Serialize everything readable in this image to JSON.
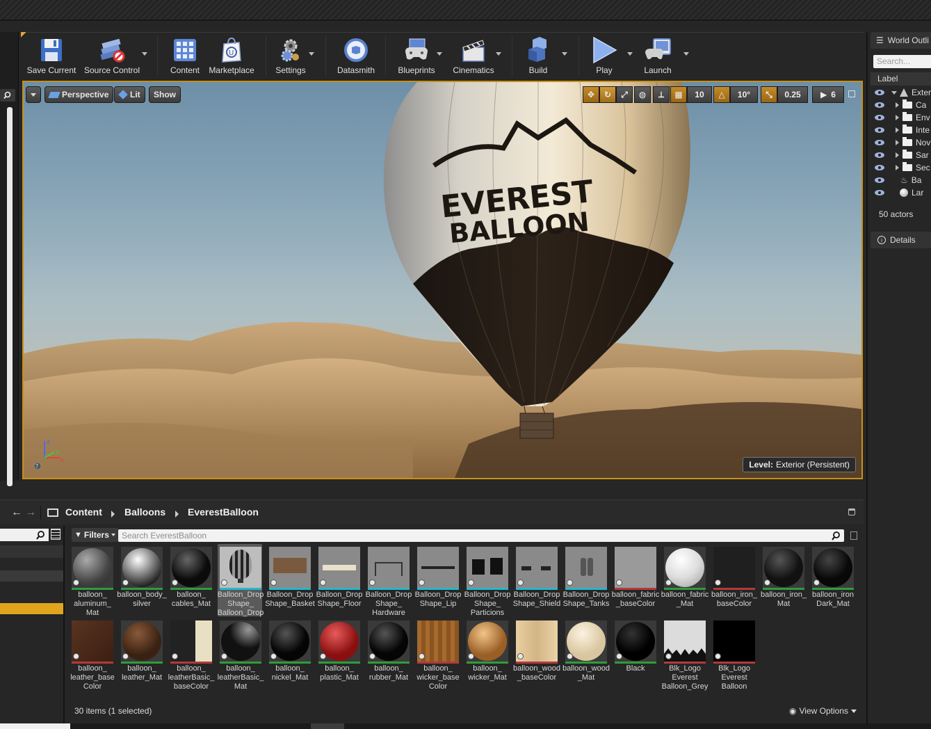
{
  "toolbar": {
    "buttons": [
      {
        "label": "Save Current"
      },
      {
        "label": "Source Control"
      },
      {
        "label": "Content"
      },
      {
        "label": "Marketplace"
      },
      {
        "label": "Settings"
      },
      {
        "label": "Datasmith"
      },
      {
        "label": "Blueprints"
      },
      {
        "label": "Cinematics"
      },
      {
        "label": "Build"
      },
      {
        "label": "Play"
      },
      {
        "label": "Launch"
      }
    ]
  },
  "viewport": {
    "view_mode": "Perspective",
    "lighting": "Lit",
    "show": "Show",
    "grid_snap": "10",
    "rotation_snap": "10°",
    "scale_snap": "0.25",
    "camera_speed": "6",
    "level_label": "Level:",
    "level_name": "Exterior (Persistent)",
    "balloon_text_1": "EVEREST",
    "balloon_text_2": "BALLOON"
  },
  "world_outliner": {
    "title": "World Outli",
    "search_placeholder": "Search...",
    "column_label": "Label",
    "rows": [
      {
        "name": "Exter",
        "type": "level"
      },
      {
        "name": "Ca",
        "type": "folder"
      },
      {
        "name": "Env",
        "type": "folder"
      },
      {
        "name": "Inte",
        "type": "folder"
      },
      {
        "name": "Nov",
        "type": "folder"
      },
      {
        "name": "Sar",
        "type": "folder"
      },
      {
        "name": "Sec",
        "type": "folder"
      },
      {
        "name": "Ba",
        "type": "actor"
      },
      {
        "name": "Lar",
        "type": "actor"
      }
    ],
    "actor_count": "50 actors"
  },
  "details": {
    "title": "Details"
  },
  "content_browser": {
    "breadcrumb": [
      "Content",
      "Balloons",
      "EverestBalloon"
    ],
    "filters_label": "Filters",
    "search_placeholder": "Search EverestBalloon",
    "items_count": "30 items (1 selected)",
    "view_options": "View Options",
    "assets": [
      {
        "name": "balloon_ aluminum_ Mat",
        "bar": "#2e9c3b"
      },
      {
        "name": "balloon_body_ silver",
        "bar": "#2e9c3b"
      },
      {
        "name": "balloon_ cables_Mat",
        "bar": "#2e9c3b"
      },
      {
        "name": "Balloon_Drop Shape_ Balloon_Drop",
        "bar": "#25b8c9"
      },
      {
        "name": "Balloon_Drop Shape_Basket",
        "bar": "#25b8c9"
      },
      {
        "name": "Balloon_Drop Shape_Floor",
        "bar": "#25b8c9"
      },
      {
        "name": "Balloon_Drop Shape_ Hardware",
        "bar": "#25b8c9"
      },
      {
        "name": "Balloon_Drop Shape_Lip",
        "bar": "#25b8c9"
      },
      {
        "name": "Balloon_Drop Shape_ Particions",
        "bar": "#25b8c9"
      },
      {
        "name": "Balloon_Drop Shape_Shield",
        "bar": "#25b8c9"
      },
      {
        "name": "Balloon_Drop Shape_Tanks",
        "bar": "#25b8c9"
      },
      {
        "name": "balloon_fabric _baseColor",
        "bar": "#b33a3a"
      },
      {
        "name": "balloon_fabric _Mat",
        "bar": "#2e9c3b"
      },
      {
        "name": "balloon_iron_ baseColor",
        "bar": "#b33a3a"
      },
      {
        "name": "balloon_iron_ Mat",
        "bar": "#2e9c3b"
      },
      {
        "name": "balloon_iron Dark_Mat",
        "bar": "#2e9c3b"
      },
      {
        "name": "balloon_ leather_base Color",
        "bar": "#b33a3a"
      },
      {
        "name": "balloon_ leather_Mat",
        "bar": "#2e9c3b"
      },
      {
        "name": "balloon_ leatherBasic_ baseColor",
        "bar": "#b33a3a"
      },
      {
        "name": "balloon_ leatherBasic_ Mat",
        "bar": "#2e9c3b"
      },
      {
        "name": "balloon_ nickel_Mat",
        "bar": "#2e9c3b"
      },
      {
        "name": "balloon_ plastic_Mat",
        "bar": "#2e9c3b"
      },
      {
        "name": "balloon_ rubber_Mat",
        "bar": "#2e9c3b"
      },
      {
        "name": "balloon_ wicker_base Color",
        "bar": "#b33a3a"
      },
      {
        "name": "balloon_ wicker_Mat",
        "bar": "#2e9c3b"
      },
      {
        "name": "balloon_wood _baseColor",
        "bar": "#b33a3a"
      },
      {
        "name": "balloon_wood _Mat",
        "bar": "#2e9c3b"
      },
      {
        "name": "Black",
        "bar": "#2e9c3b"
      },
      {
        "name": "Blk_Logo Everest Balloon_Grey",
        "bar": "#b33a3a"
      },
      {
        "name": "Blk_Logo Everest Balloon",
        "bar": "#b33a3a"
      }
    ]
  },
  "colors": {
    "accent": "#c99018",
    "panel_bg": "#262626",
    "dark_bg": "#1e1e1e"
  }
}
